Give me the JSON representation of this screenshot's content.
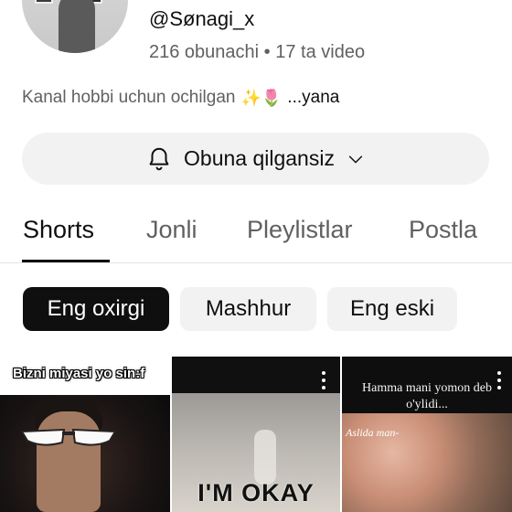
{
  "channel": {
    "handle": "@Sønagi_x",
    "stats": "216 obunachi • 17 ta video",
    "description": "Kanal hobbi uchun ochilgan",
    "description_emojis": "✨🌷",
    "description_more": "...yana"
  },
  "subscribe_button": {
    "label": "Obuna qilgansiz",
    "icon": "bell-icon",
    "dropdown_icon": "chevron-down-icon"
  },
  "tabs": [
    {
      "label": "Shorts",
      "active": true
    },
    {
      "label": "Jonli",
      "active": false
    },
    {
      "label": "Pleylistlar",
      "active": false
    },
    {
      "label": "Postla",
      "active": false
    }
  ],
  "chips": [
    {
      "label": "Eng oxirgi",
      "active": true
    },
    {
      "label": "Mashhur",
      "active": false
    },
    {
      "label": "Eng eski",
      "active": false
    }
  ],
  "shorts": [
    {
      "caption": "Bizni miyasi yo sin:f"
    },
    {
      "caption": "I'M OKAY"
    },
    {
      "caption": "Hamma mani yomon deb o'ylidi...",
      "subcaption": "Aslida man-"
    }
  ],
  "colors": {
    "text_primary": "#0f0f0f",
    "text_secondary": "#606060",
    "chip_active_bg": "#0f0f0f",
    "chip_bg": "#f2f2f2"
  }
}
